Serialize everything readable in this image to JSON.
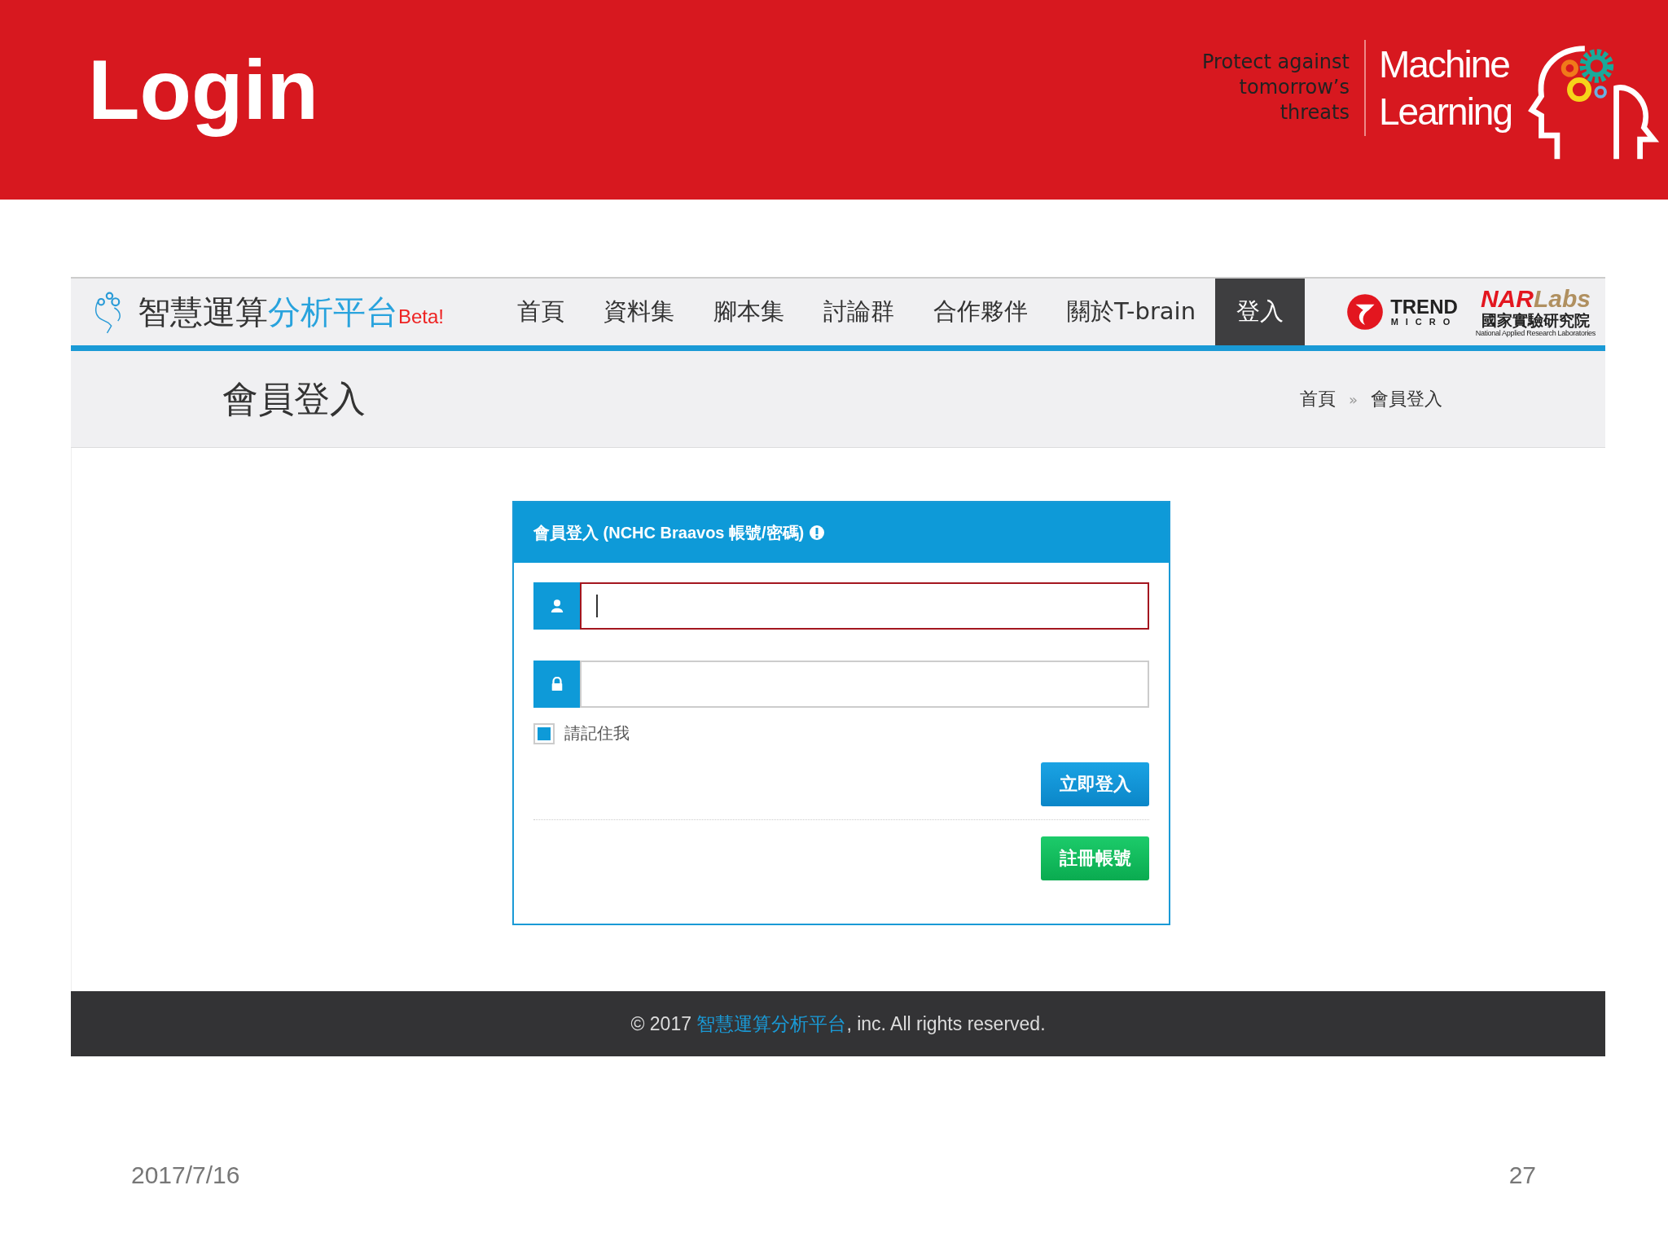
{
  "slide": {
    "title": "Login",
    "tagline": [
      "Protect against",
      "tomorrow’s",
      "threats"
    ],
    "brand": [
      "Machine",
      "Learning"
    ],
    "date": "2017/7/16",
    "page_number": "27"
  },
  "site": {
    "logo": {
      "dark": "智慧運算",
      "blue": "分析平台",
      "beta": "Beta!"
    },
    "nav": [
      {
        "label": "首頁",
        "selected": false
      },
      {
        "label": "資料集",
        "selected": false
      },
      {
        "label": "腳本集",
        "selected": false
      },
      {
        "label": "討論群",
        "selected": false
      },
      {
        "label": "合作夥伴",
        "selected": false
      },
      {
        "label": "關於T-brain",
        "selected": false
      },
      {
        "label": "登入",
        "selected": true
      }
    ],
    "partners": {
      "trend": [
        "TREND",
        "MICRO"
      ],
      "nar": [
        "NAR",
        "Labs",
        "國家實驗研究院",
        "National Applied Research Laboratories"
      ]
    },
    "page_title": "會員登入",
    "breadcrumb": [
      "首頁",
      "»",
      "會員登入"
    ],
    "login": {
      "header": "會員登入 (NCHC Braavos 帳號/密碼)",
      "remember": {
        "label": "請記住我",
        "checked": true
      },
      "login_button": "立即登入",
      "register_button": "註冊帳號"
    },
    "footer": {
      "before": "© 2017 ",
      "link": "智慧運算分析平台",
      "after": ", inc. All rights reserved."
    }
  }
}
